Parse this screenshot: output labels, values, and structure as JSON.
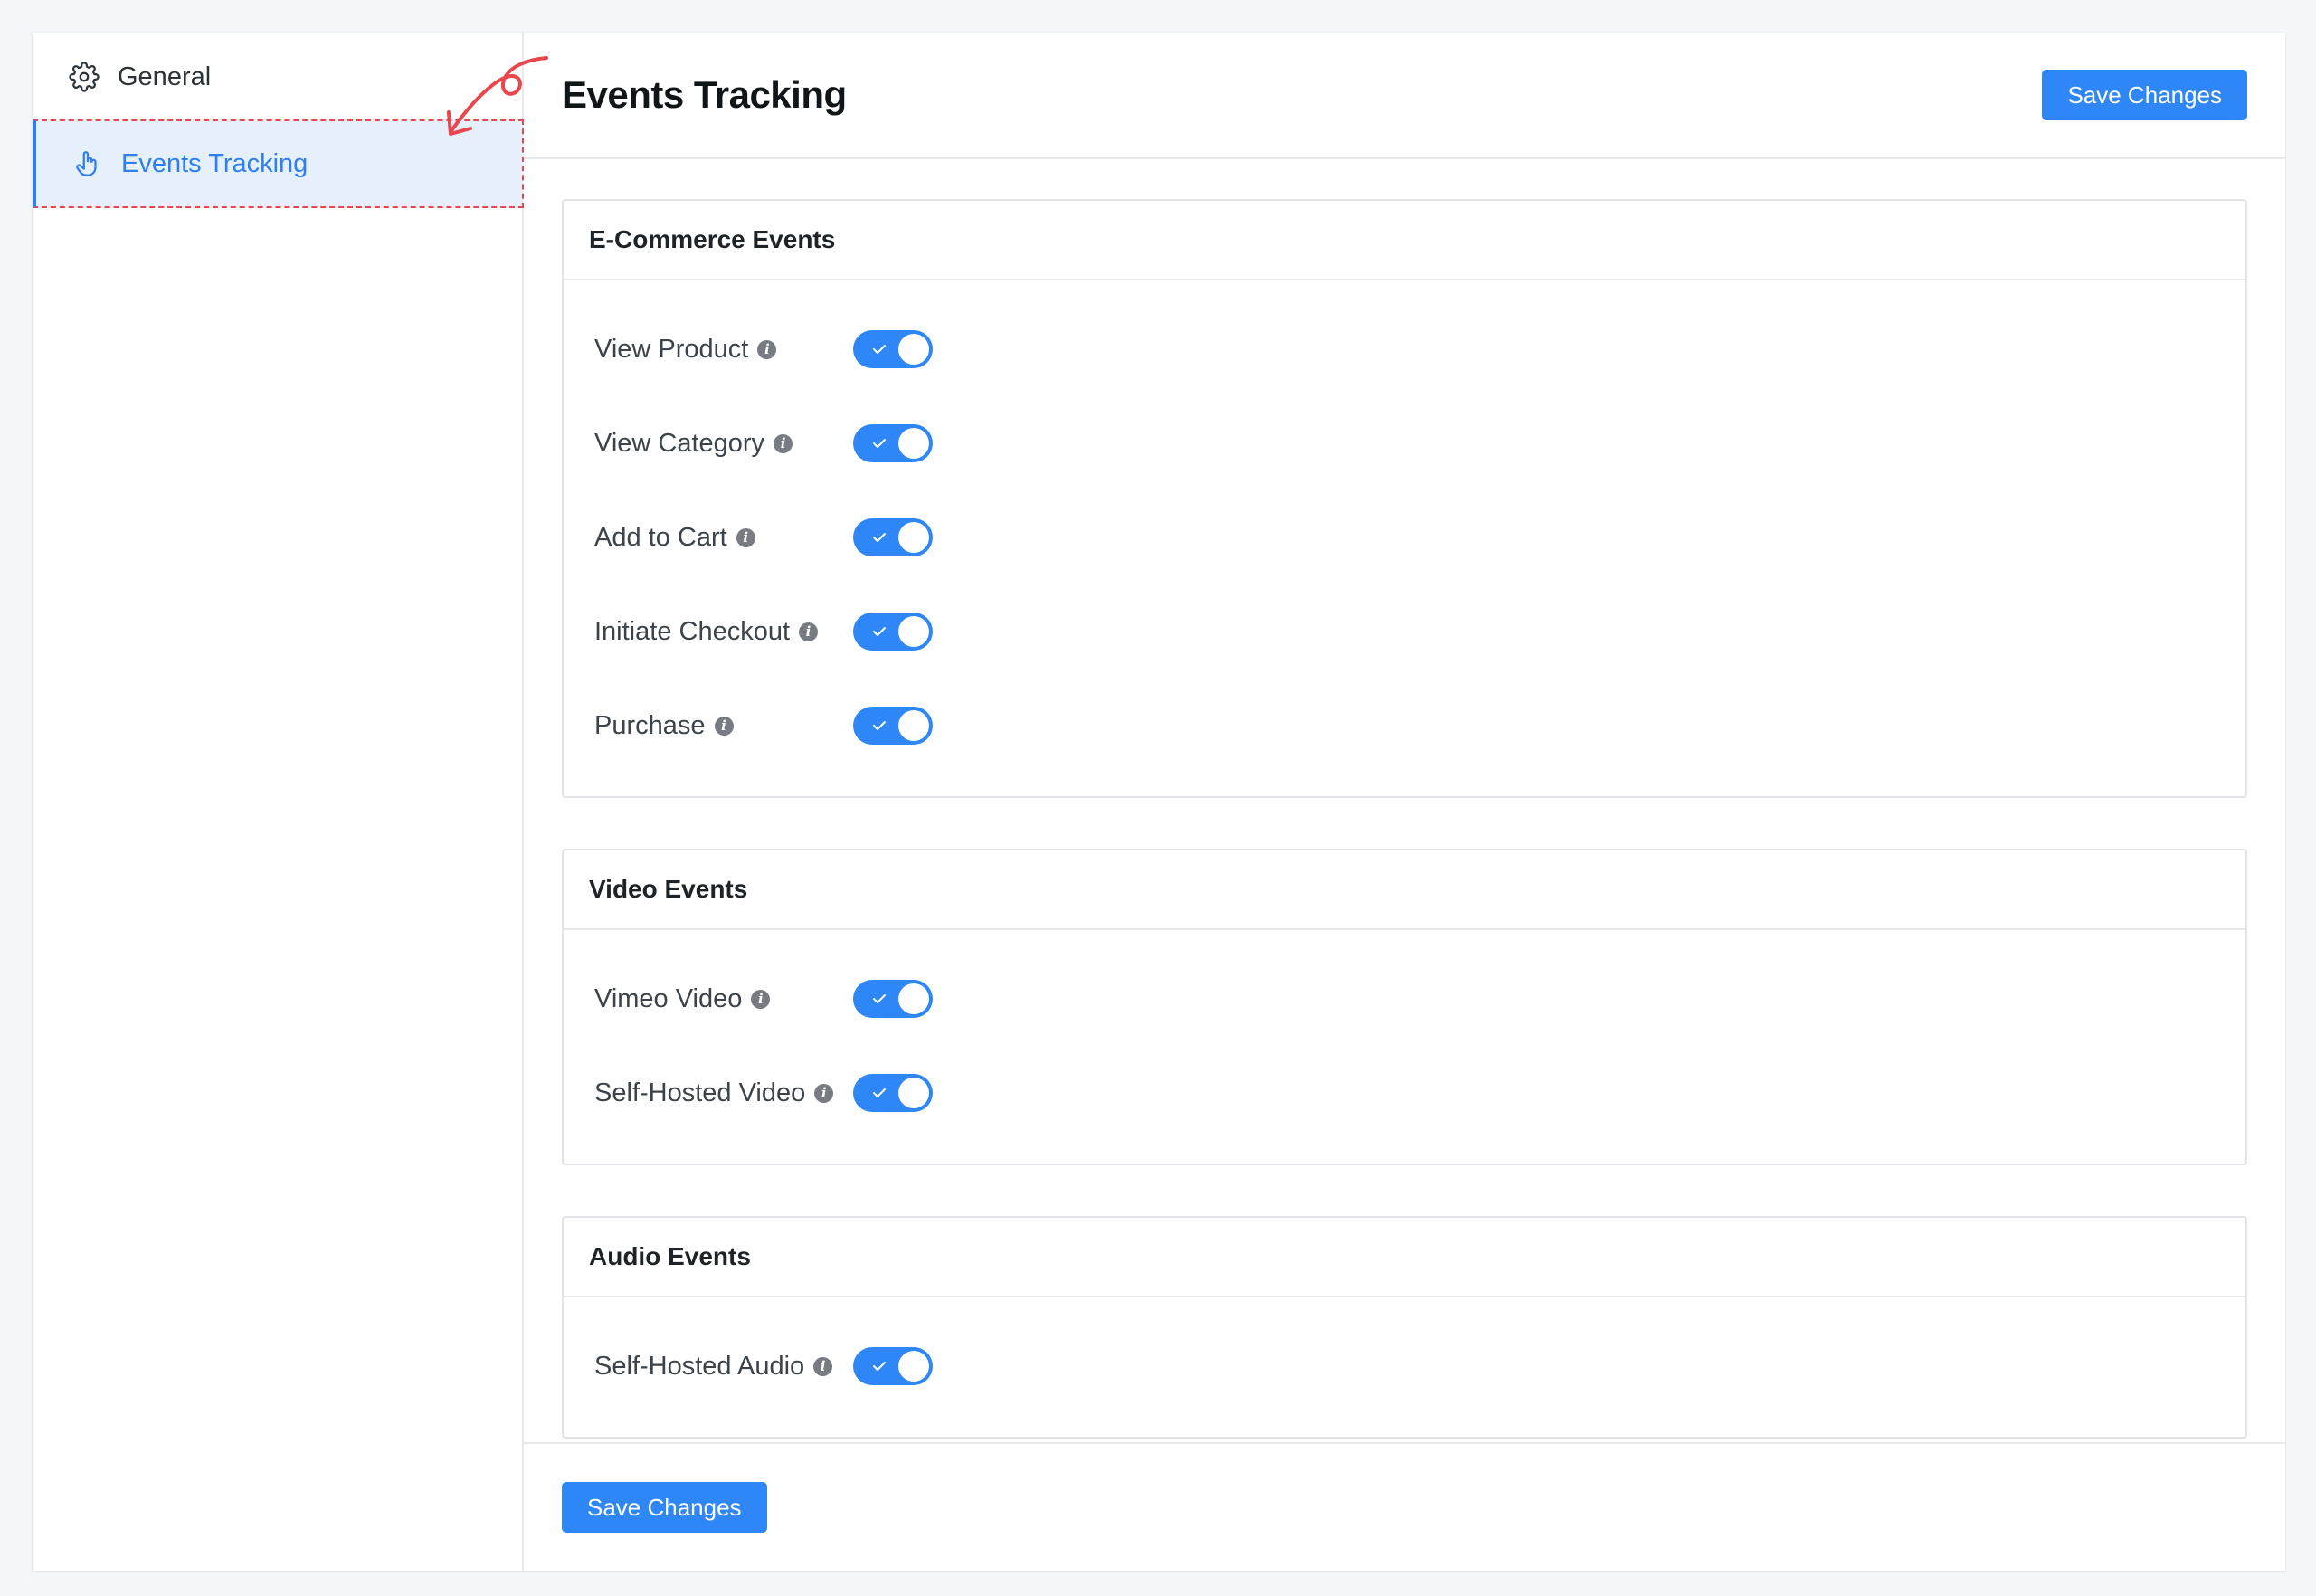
{
  "sidebar": {
    "items": [
      {
        "label": "General",
        "icon": "gear-icon"
      },
      {
        "label": "Events Tracking",
        "icon": "hand-pointer-icon"
      }
    ]
  },
  "header": {
    "title": "Events Tracking",
    "save_label": "Save Changes"
  },
  "sections": [
    {
      "title": "E-Commerce Events",
      "events": [
        {
          "label": "View Product",
          "enabled": true
        },
        {
          "label": "View Category",
          "enabled": true
        },
        {
          "label": "Add to Cart",
          "enabled": true
        },
        {
          "label": "Initiate Checkout",
          "enabled": true
        },
        {
          "label": "Purchase",
          "enabled": true
        }
      ]
    },
    {
      "title": "Video Events",
      "events": [
        {
          "label": "Vimeo Video",
          "enabled": true
        },
        {
          "label": "Self-Hosted Video",
          "enabled": true
        }
      ]
    },
    {
      "title": "Audio Events",
      "events": [
        {
          "label": "Self-Hosted Audio",
          "enabled": true
        }
      ]
    }
  ],
  "footer": {
    "save_label": "Save Changes"
  },
  "colors": {
    "accent": "#2f87f7",
    "active_bg": "#e6f0fd",
    "annotation": "#e8484d"
  }
}
